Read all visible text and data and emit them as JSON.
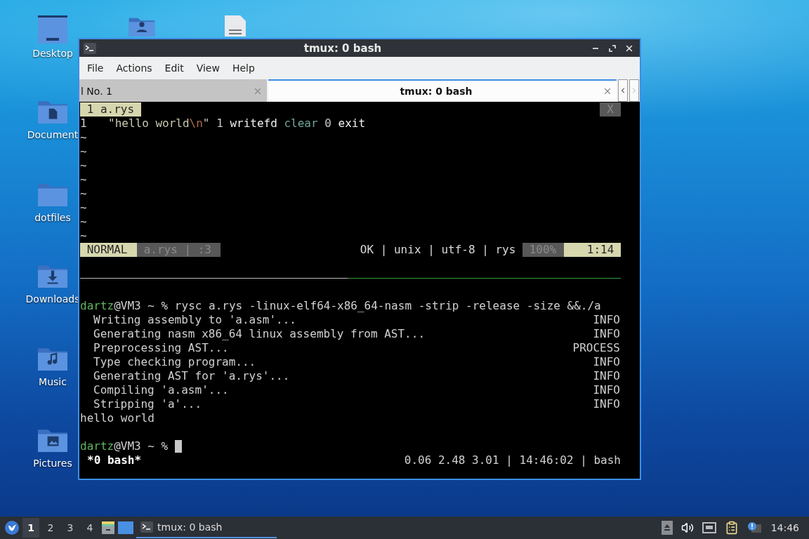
{
  "desktop_icons": [
    {
      "kind": "desktop",
      "label": "Desktop"
    },
    {
      "kind": "documents",
      "label": "Document"
    },
    {
      "kind": "folder",
      "label": "dotfiles"
    },
    {
      "kind": "downloads",
      "label": "Downloads"
    },
    {
      "kind": "music",
      "label": "Music"
    },
    {
      "kind": "pictures",
      "label": "Pictures"
    },
    {
      "kind": "home"
    },
    {
      "kind": "file"
    }
  ],
  "window": {
    "title": "tmux: 0 bash",
    "menu": [
      "File",
      "Actions",
      "Edit",
      "View",
      "Help"
    ],
    "tabs": [
      {
        "label": "l No. 1",
        "selected": false
      },
      {
        "label": "tmux: 0 bash",
        "selected": true
      }
    ]
  },
  "vim": {
    "tabline": {
      "tab": " 1 a.rys ",
      "close": "X"
    },
    "lines": [
      {
        "number": "1",
        "tokens": [
          {
            "text": "\"hello world",
            "kind": "string"
          },
          {
            "text": "\\n",
            "kind": "escape"
          },
          {
            "text": "\"",
            "kind": "string"
          },
          {
            "text": "1",
            "kind": "number"
          },
          {
            "text": "writefd",
            "kind": "word"
          },
          {
            "text": "clear",
            "kind": "builtin"
          },
          {
            "text": "0",
            "kind": "number"
          },
          {
            "text": "exit",
            "kind": "word"
          }
        ]
      }
    ],
    "empty_lines": [
      "~",
      "~",
      "~",
      "~",
      "~",
      "~",
      "~",
      "~"
    ],
    "statusline": {
      "mode": "NORMAL",
      "file": "a.rys | :3",
      "info": "OK | unix | utf-8 | rys",
      "percent": "100%",
      "position": "1:14"
    }
  },
  "shell": [
    {
      "kind": "prompt",
      "user": "dartz",
      "rest": "@VM3 ~ % rysc a.rys -linux-elf64-x86_64-nasm -strip -release -size &&./a"
    },
    {
      "kind": "log",
      "message": "Writing assembly to 'a.asm'...",
      "level": "INFO"
    },
    {
      "kind": "log",
      "message": "Generating nasm x86_64 linux assembly from AST...",
      "level": "INFO"
    },
    {
      "kind": "log",
      "message": "Preprocessing AST...",
      "level": "PROCESS"
    },
    {
      "kind": "log",
      "message": "Type checking program...",
      "level": "INFO"
    },
    {
      "kind": "log",
      "message": "Generating AST for 'a.rys'...",
      "level": "INFO"
    },
    {
      "kind": "log",
      "message": "Compiling 'a.asm'...",
      "level": "INFO"
    },
    {
      "kind": "log",
      "message": "Stripping 'a'...",
      "level": "INFO"
    },
    {
      "kind": "output",
      "text": "hello world"
    },
    {
      "kind": "blank"
    },
    {
      "kind": "prompt",
      "user": "dartz",
      "rest": "@VM3 ~ % ",
      "cursor": true
    }
  ],
  "tmux_status": {
    "window": "*0 bash*",
    "info": "0.06 2.48 3.01 | 14:46:02 | bash"
  },
  "taskbar": {
    "workspaces": [
      {
        "label": "1",
        "selected": true
      },
      {
        "label": "2",
        "selected": false
      },
      {
        "label": "3",
        "selected": false
      },
      {
        "label": "4",
        "selected": false
      }
    ],
    "task": {
      "title": "tmux: 0 bash",
      "selected": true
    },
    "clock": "14:46"
  }
}
